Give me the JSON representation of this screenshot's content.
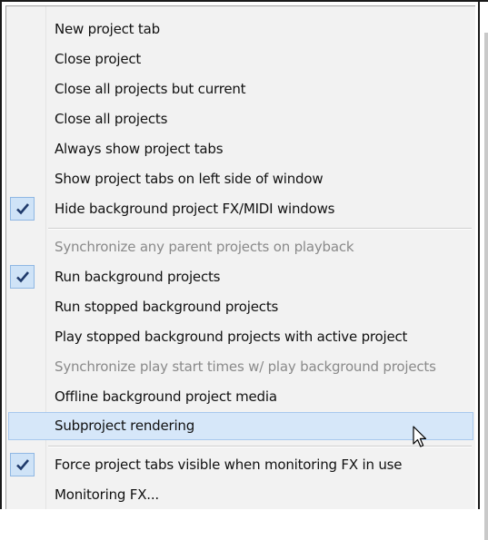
{
  "menu": {
    "items": [
      {
        "label": "New project tab",
        "checked": false,
        "disabled": false
      },
      {
        "label": "Close project",
        "checked": false,
        "disabled": false
      },
      {
        "label": "Close all projects but current",
        "checked": false,
        "disabled": false
      },
      {
        "label": "Close all projects",
        "checked": false,
        "disabled": false
      },
      {
        "label": "Always show project tabs",
        "checked": false,
        "disabled": false
      },
      {
        "label": "Show project tabs on left side of window",
        "checked": false,
        "disabled": false
      },
      {
        "label": "Hide background project FX/MIDI windows",
        "checked": true,
        "disabled": false
      },
      {
        "label": "Synchronize any parent projects on playback",
        "checked": false,
        "disabled": true
      },
      {
        "label": "Run background projects",
        "checked": true,
        "disabled": false
      },
      {
        "label": "Run stopped background projects",
        "checked": false,
        "disabled": false
      },
      {
        "label": "Play stopped background projects with active project",
        "checked": false,
        "disabled": false
      },
      {
        "label": "Synchronize play start times w/ play background projects",
        "checked": false,
        "disabled": true
      },
      {
        "label": "Offline background project media",
        "checked": false,
        "disabled": false
      },
      {
        "label": "Subproject rendering",
        "checked": false,
        "disabled": false,
        "highlighted": true
      },
      {
        "label": "Force project tabs visible when monitoring FX in use",
        "checked": true,
        "disabled": false
      },
      {
        "label": "Monitoring FX...",
        "checked": false,
        "disabled": false
      }
    ]
  },
  "colors": {
    "highlight": "#d6e7f9",
    "check": "#1f3a6b",
    "disabled_text": "#8a8a8a"
  },
  "icons": {
    "check": "checkmark-icon",
    "cursor": "mouse-pointer-icon"
  }
}
